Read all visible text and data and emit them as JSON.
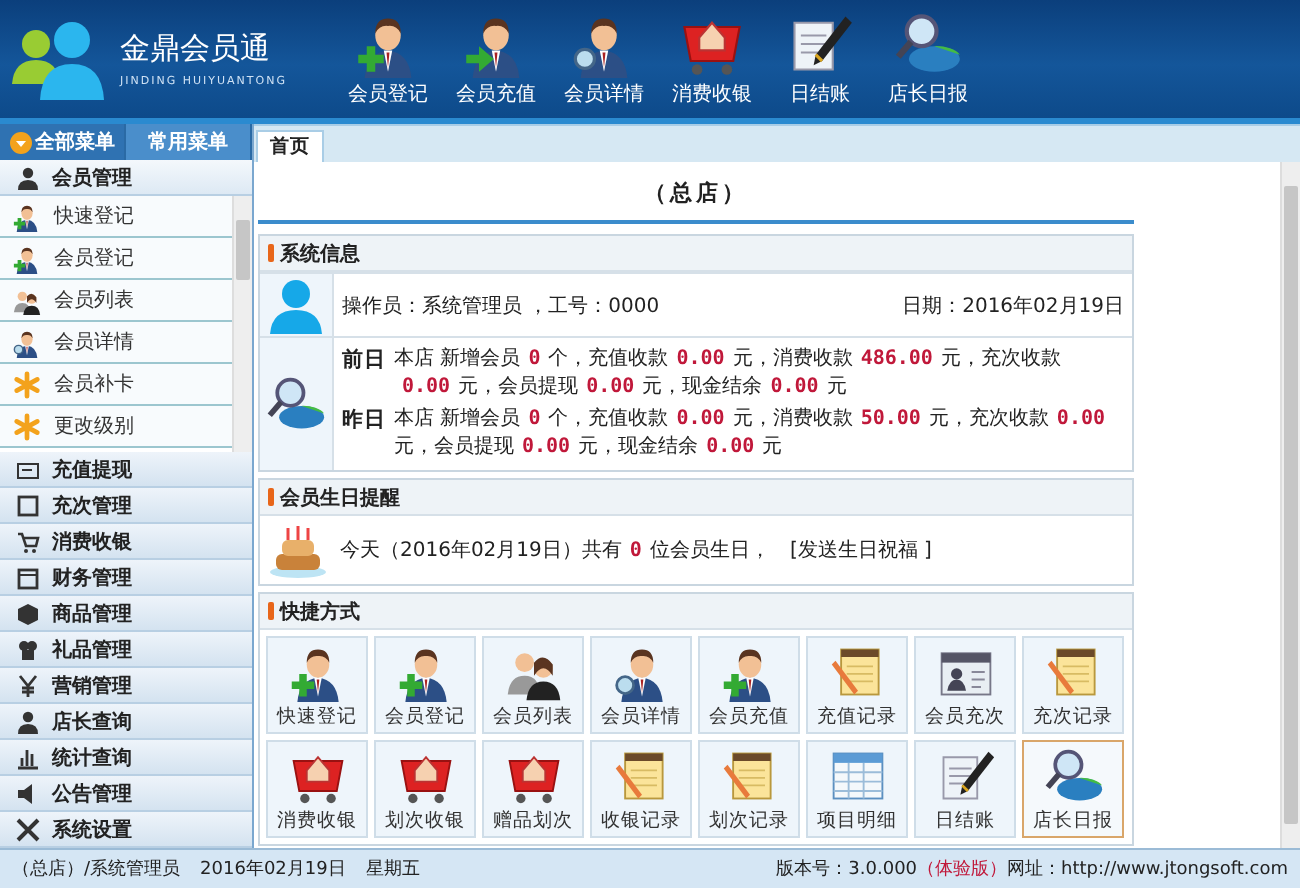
{
  "header": {
    "logo_title": "金鼎会员通",
    "logo_subtitle": "JINDING HUIYUANTONG",
    "nav": [
      {
        "label": "会员登记"
      },
      {
        "label": "会员充值"
      },
      {
        "label": "会员详情"
      },
      {
        "label": "消费收银"
      },
      {
        "label": "日结账"
      },
      {
        "label": "店长日报"
      }
    ]
  },
  "sidebar": {
    "tabs": [
      {
        "label": "全部菜单",
        "selected": true
      },
      {
        "label": "常用菜单",
        "selected": false
      }
    ],
    "groups": [
      {
        "label": "会员管理",
        "children": [
          {
            "label": "快速登记"
          },
          {
            "label": "会员登记"
          },
          {
            "label": "会员列表"
          },
          {
            "label": "会员详情"
          },
          {
            "label": "会员补卡"
          },
          {
            "label": "更改级别"
          }
        ]
      },
      {
        "label": "充值提现"
      },
      {
        "label": "充次管理"
      },
      {
        "label": "消费收银"
      },
      {
        "label": "财务管理"
      },
      {
        "label": "商品管理"
      },
      {
        "label": "礼品管理"
      },
      {
        "label": "营销管理"
      },
      {
        "label": "店长查询"
      },
      {
        "label": "统计查询"
      },
      {
        "label": "公告管理"
      },
      {
        "label": "系统设置"
      }
    ]
  },
  "main": {
    "tabs": [
      {
        "label": "首页",
        "selected": true
      }
    ],
    "title": "（总店）",
    "system_info": {
      "title": "系统信息",
      "operator": "操作员：系统管理员 ，工号：0000",
      "date": "日期：2016年02月19日",
      "days": [
        {
          "label": "前日",
          "segments": [
            {
              "kind": "text",
              "text": "本店 新增会员"
            },
            {
              "kind": "number",
              "text": "0"
            },
            {
              "kind": "text",
              "text": "个，充值收款"
            },
            {
              "kind": "number",
              "text": "0.00"
            },
            {
              "kind": "text",
              "text": "元，消费收款"
            },
            {
              "kind": "number",
              "text": "486.00"
            },
            {
              "kind": "text",
              "text": "元，充次收款"
            },
            {
              "kind": "number",
              "text": "0.00"
            },
            {
              "kind": "text",
              "text": "元，会员提现"
            },
            {
              "kind": "number",
              "text": "0.00"
            },
            {
              "kind": "text",
              "text": "元，现金结余"
            },
            {
              "kind": "number",
              "text": "0.00"
            },
            {
              "kind": "text",
              "text": "元"
            }
          ]
        },
        {
          "label": "昨日",
          "segments": [
            {
              "kind": "text",
              "text": "本店 新增会员"
            },
            {
              "kind": "number",
              "text": "0"
            },
            {
              "kind": "text",
              "text": "个，充值收款"
            },
            {
              "kind": "number",
              "text": "0.00"
            },
            {
              "kind": "text",
              "text": "元，消费收款"
            },
            {
              "kind": "number",
              "text": "50.00"
            },
            {
              "kind": "text",
              "text": "元，充次收款"
            },
            {
              "kind": "number",
              "text": "0.00"
            },
            {
              "kind": "text",
              "text": "元，会员提现"
            },
            {
              "kind": "number",
              "text": "0.00"
            },
            {
              "kind": "text",
              "text": "元，现金结余"
            },
            {
              "kind": "number",
              "text": "0.00"
            },
            {
              "kind": "text",
              "text": "元"
            }
          ]
        }
      ]
    },
    "birthday": {
      "title": "会员生日提醒",
      "segments": [
        {
          "kind": "text",
          "text": "今天（2016年02月19日）共有"
        },
        {
          "kind": "number",
          "text": "0"
        },
        {
          "kind": "text",
          "text": "位会员生日，"
        }
      ],
      "link": "[发送生日祝福 ]"
    },
    "shortcuts": {
      "title": "快捷方式",
      "items": [
        {
          "label": "快速登记",
          "selected": false
        },
        {
          "label": "会员登记",
          "selected": false
        },
        {
          "label": "会员列表",
          "selected": false
        },
        {
          "label": "会员详情",
          "selected": false
        },
        {
          "label": "会员充值",
          "selected": false
        },
        {
          "label": "充值记录",
          "selected": false
        },
        {
          "label": "会员充次",
          "selected": false
        },
        {
          "label": "充次记录",
          "selected": false
        },
        {
          "label": "消费收银",
          "selected": false
        },
        {
          "label": "划次收银",
          "selected": false
        },
        {
          "label": "赠品划次",
          "selected": false
        },
        {
          "label": "收银记录",
          "selected": false
        },
        {
          "label": "划次记录",
          "selected": false
        },
        {
          "label": "项目明细",
          "selected": false
        },
        {
          "label": "日结账",
          "selected": false
        },
        {
          "label": "店长日报",
          "selected": true
        }
      ]
    }
  },
  "status_bar": {
    "left": [
      "（总店）/系统管理员",
      "2016年02月19日",
      "星期五"
    ],
    "version": "版本号：3.0.000",
    "edition": "（体验版）",
    "website": "网址：http://www.jtongsoft.com"
  }
}
